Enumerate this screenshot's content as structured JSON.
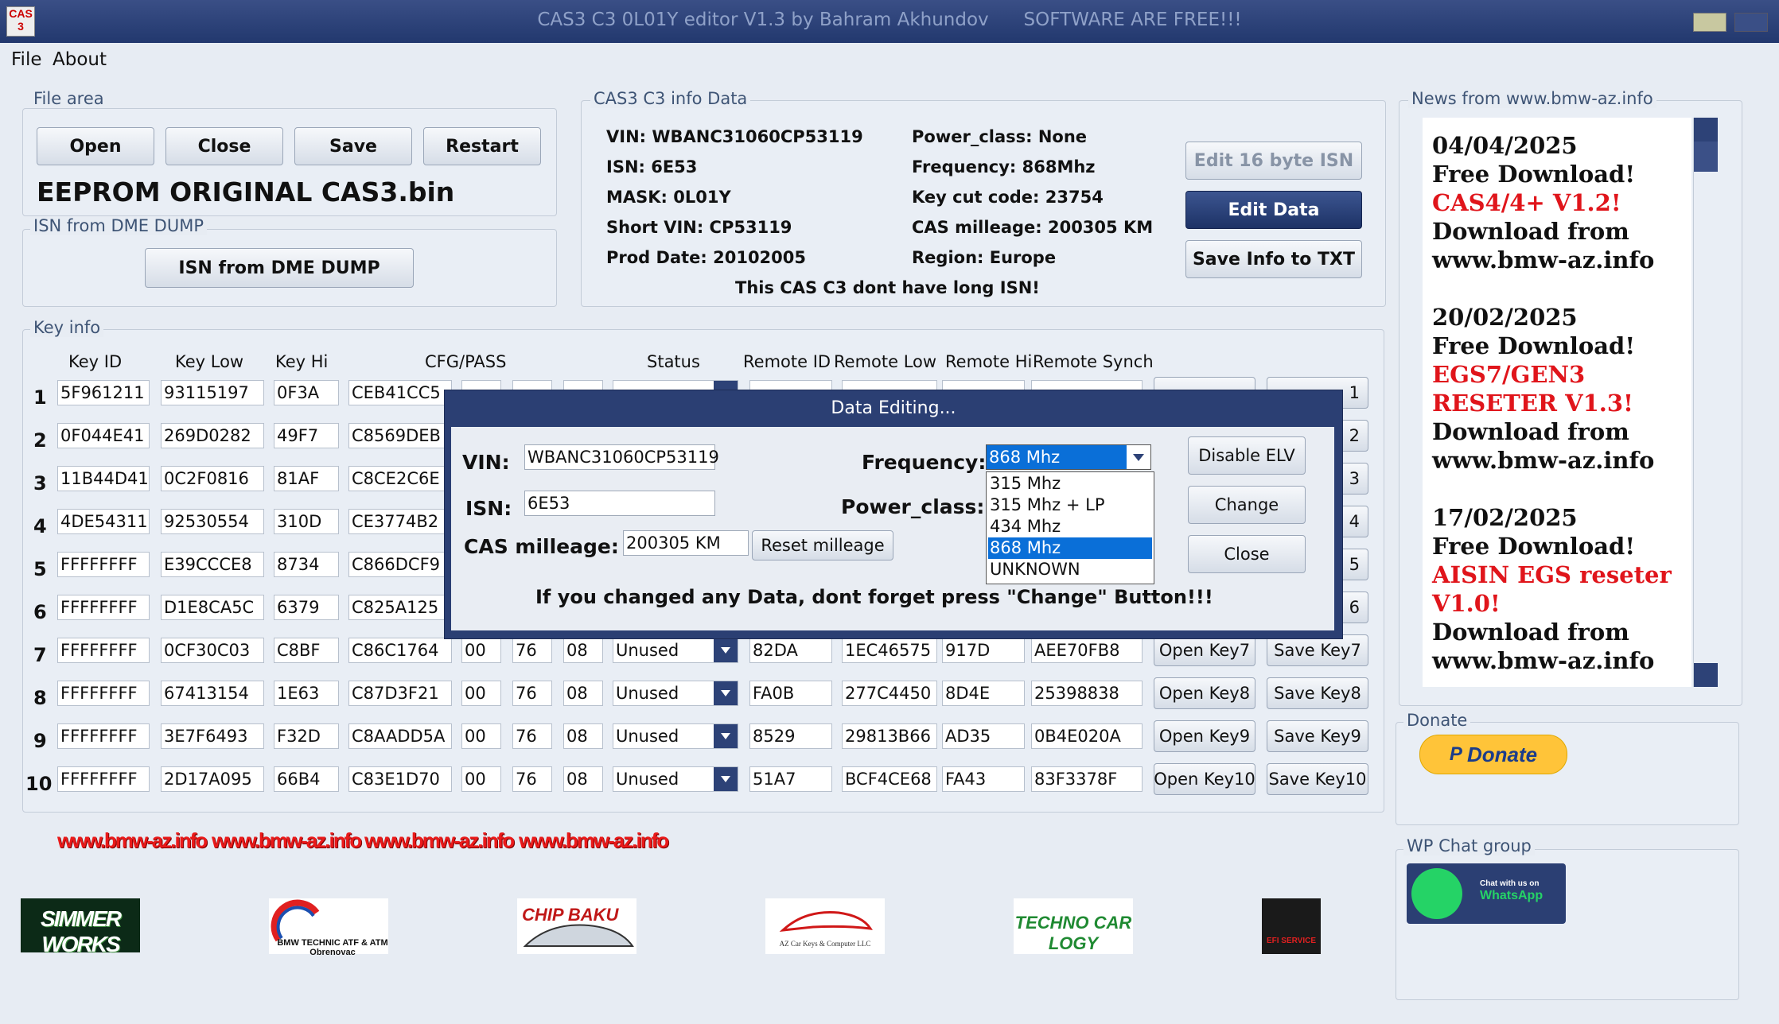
{
  "window": {
    "title": "CAS3 C3 0L01Y editor V1.3 by Bahram Akhundov      SOFTWARE ARE FREE!!!",
    "icon_text": "CAS 3"
  },
  "menu": [
    "File",
    "About"
  ],
  "file_area": {
    "label": "File area",
    "buttons": [
      "Open",
      "Close",
      "Save",
      "Restart"
    ],
    "filename": "EEPROM ORIGINAL CAS3.bin"
  },
  "isn_dme": {
    "label": "ISN from DME DUMP",
    "button": "ISN from DME DUMP"
  },
  "info": {
    "label": "CAS3 C3 info Data",
    "left": [
      "VIN: WBANC31060CP53119",
      "ISN: 6E53",
      "MASK: 0L01Y",
      "Short VIN: CP53119",
      "Prod Date: 20102005"
    ],
    "right": [
      "Power_class: None",
      "Frequency: 868Mhz",
      "Key cut code: 23754",
      "CAS milleage: 200305 KM",
      "Region: Europe"
    ],
    "note": "This CAS C3 dont have long ISN!",
    "buttons": [
      "Edit 16 byte ISN",
      "Edit Data",
      "Save Info to TXT"
    ]
  },
  "key_info": {
    "label": "Key info",
    "headers": [
      "Key ID",
      "Key Low",
      "Key Hi",
      "CFG/PASS",
      "Status",
      "Remote ID",
      "Remote Low",
      "Remote Hi",
      "Remote Synch"
    ],
    "rows": [
      {
        "n": "1",
        "id": "5F961211",
        "low": "93115197",
        "hi": "0F3A",
        "cfg": "CEB41CC5"
      },
      {
        "n": "2",
        "id": "0F044E41",
        "low": "269D0282",
        "hi": "49F7",
        "cfg": "C8569DEB"
      },
      {
        "n": "3",
        "id": "11B44D41",
        "low": "0C2F0816",
        "hi": "81AF",
        "cfg": "C8CE2C6E"
      },
      {
        "n": "4",
        "id": "4DE54311",
        "low": "92530554",
        "hi": "310D",
        "cfg": "CE3774B2"
      },
      {
        "n": "5",
        "id": "FFFFFFFF",
        "low": "E39CCCE8",
        "hi": "8734",
        "cfg": "C866DCF9"
      },
      {
        "n": "6",
        "id": "FFFFFFFF",
        "low": "D1E8CA5C",
        "hi": "6379",
        "cfg": "C825A125"
      },
      {
        "n": "7",
        "id": "FFFFFFFF",
        "low": "0CF30C03",
        "hi": "C8BF",
        "cfg": "C86C1764",
        "p1": "00",
        "p2": "76",
        "p3": "08",
        "status": "Unused",
        "rid": "82DA",
        "rlow": "1EC46575",
        "rhi": "917D",
        "rsync": "AEE70FB8",
        "open": "Open Key7",
        "save": "Save Key7"
      },
      {
        "n": "8",
        "id": "FFFFFFFF",
        "low": "67413154",
        "hi": "1E63",
        "cfg": "C87D3F21",
        "p1": "00",
        "p2": "76",
        "p3": "08",
        "status": "Unused",
        "rid": "FA0B",
        "rlow": "277C4450",
        "rhi": "8D4E",
        "rsync": "25398838",
        "open": "Open Key8",
        "save": "Save Key8"
      },
      {
        "n": "9",
        "id": "FFFFFFFF",
        "low": "3E7F6493",
        "hi": "F32D",
        "cfg": "C8AADD5A",
        "p1": "00",
        "p2": "76",
        "p3": "08",
        "status": "Unused",
        "rid": "8529",
        "rlow": "29813B66",
        "rhi": "AD35",
        "rsync": "0B4E020A",
        "open": "Open Key9",
        "save": "Save Key9"
      },
      {
        "n": "10",
        "id": "FFFFFFFF",
        "low": "2D17A095",
        "hi": "66B4",
        "cfg": "C83E1D70",
        "p1": "00",
        "p2": "76",
        "p3": "08",
        "status": "Unused",
        "rid": "51A7",
        "rlow": "BCF4CE68",
        "rhi": "FA43",
        "rsync": "83F3378F",
        "open": "Open Key10",
        "save": "Save Key10"
      }
    ],
    "side_suffix": [
      "1",
      "2",
      "3",
      "4",
      "5",
      "6"
    ]
  },
  "links": [
    "www.bmw-az.info",
    "www.bmw-az.info",
    "www.bmw-az.info",
    "www.bmw-az.info"
  ],
  "logos": [
    "SIMMER WORKS",
    "BMW TECHNIC ATF & ATM Obrenovac",
    "CHIP BAKU",
    "AZ Car Keys & Computer LLC",
    "TECHNO CAR LOGY",
    "EFI SERVICE"
  ],
  "news": {
    "label": "News from www.bmw-az.info",
    "items": [
      {
        "date": "04/04/2025",
        "head": "Free Download!",
        "title": [
          "CAS4/4+ V1.2!"
        ],
        "tail": [
          "Download from",
          "www.bmw-az.info"
        ]
      },
      {
        "date": "20/02/2025",
        "head": "Free Download!",
        "title": [
          "EGS7/GEN3",
          "RESETER V1.3!"
        ],
        "tail": [
          "Download from",
          "www.bmw-az.info"
        ]
      },
      {
        "date": "17/02/2025",
        "head": "Free Download!",
        "title": [
          "AISIN EGS reseter",
          "V1.0!"
        ],
        "tail": [
          "Download from",
          "www.bmw-az.info"
        ]
      }
    ]
  },
  "donate": {
    "label": "Donate",
    "button": "Donate"
  },
  "wp": {
    "label": "WP Chat group",
    "badge_line1": "Chat with us on",
    "badge_line2": "WhatsApp"
  },
  "dialog": {
    "title": "Data Editing...",
    "vin_label": "VIN:",
    "vin": "WBANC31060CP53119",
    "isn_label": "ISN:",
    "isn": "6E53",
    "mileage_label": "CAS milleage:",
    "mileage": "200305 KM",
    "reset_button": "Reset milleage",
    "freq_label": "Frequency:",
    "freq_selected": "868 Mhz",
    "freq_options": [
      "315 Mhz",
      "315 Mhz + LP",
      "434 Mhz",
      "868 Mhz",
      "UNKNOWN"
    ],
    "power_label": "Power_class:",
    "buttons": [
      "Disable ELV",
      "Change",
      "Close"
    ],
    "warning": "If you changed any Data, dont forget press \"Change\" Button!!!"
  },
  "colors": {
    "titlebar": "#22386e",
    "accent": "#1d3266",
    "link_red": "#ea1a1a",
    "selection": "#0a6fd8"
  }
}
